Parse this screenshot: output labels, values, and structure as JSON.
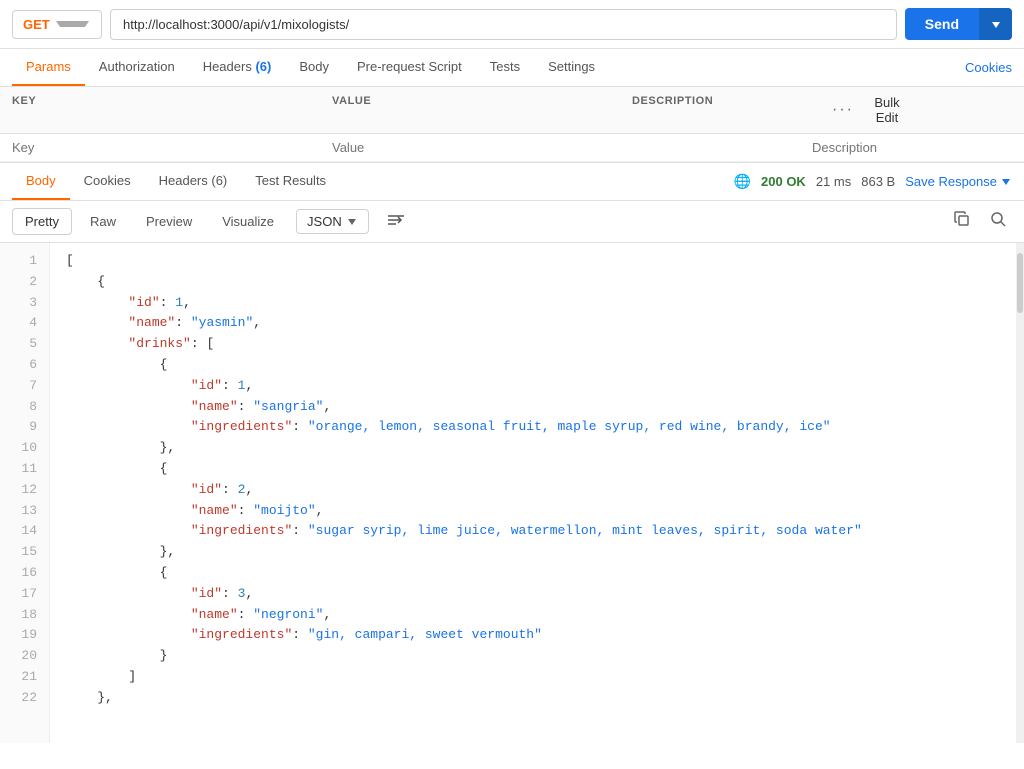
{
  "topbar": {
    "method": "GET",
    "method_color": "#f60",
    "url": "http://localhost:3000/api/v1/mixologists/",
    "send_label": "Send"
  },
  "request_tabs": [
    {
      "id": "params",
      "label": "Params",
      "active": true,
      "badge": null
    },
    {
      "id": "authorization",
      "label": "Authorization",
      "active": false,
      "badge": null
    },
    {
      "id": "headers",
      "label": "Headers",
      "active": false,
      "badge": "(6)"
    },
    {
      "id": "body",
      "label": "Body",
      "active": false,
      "badge": null
    },
    {
      "id": "prerequest",
      "label": "Pre-request Script",
      "active": false,
      "badge": null
    },
    {
      "id": "tests",
      "label": "Tests",
      "active": false,
      "badge": null
    },
    {
      "id": "settings",
      "label": "Settings",
      "active": false,
      "badge": null
    }
  ],
  "cookies_link": "Cookies",
  "params_table": {
    "columns": [
      "KEY",
      "VALUE",
      "DESCRIPTION"
    ],
    "placeholder_key": "Key",
    "placeholder_value": "Value",
    "placeholder_desc": "Description",
    "bulk_edit": "Bulk Edit"
  },
  "response_tabs": [
    {
      "id": "body",
      "label": "Body",
      "active": true
    },
    {
      "id": "cookies",
      "label": "Cookies",
      "active": false
    },
    {
      "id": "headers",
      "label": "Headers (6)",
      "active": false
    },
    {
      "id": "test_results",
      "label": "Test Results",
      "active": false
    }
  ],
  "response_status": {
    "globe": "🌐",
    "status": "200 OK",
    "time": "21 ms",
    "size": "863 B",
    "save_response": "Save Response"
  },
  "format_bar": {
    "pretty": "Pretty",
    "raw": "Raw",
    "preview": "Preview",
    "visualize": "Visualize",
    "format": "JSON",
    "wrap_icon": "≡→"
  },
  "json_lines": [
    {
      "num": 1,
      "content": "[",
      "type": "bracket"
    },
    {
      "num": 2,
      "content": "    {",
      "type": "bracket"
    },
    {
      "num": 3,
      "content": "        \"id\": 1,",
      "key": "id",
      "val": "1",
      "type": "num"
    },
    {
      "num": 4,
      "content": "        \"name\": \"yasmin\",",
      "key": "name",
      "val": "yasmin",
      "type": "str"
    },
    {
      "num": 5,
      "content": "        \"drinks\": [",
      "key": "drinks",
      "type": "arr"
    },
    {
      "num": 6,
      "content": "            {",
      "type": "bracket"
    },
    {
      "num": 7,
      "content": "                \"id\": 1,",
      "key": "id",
      "val": "1",
      "type": "num"
    },
    {
      "num": 8,
      "content": "                \"name\": \"sangria\",",
      "key": "name",
      "val": "sangria",
      "type": "str"
    },
    {
      "num": 9,
      "content": "                \"ingredients\": \"orange, lemon, seasonal fruit, maple syrup, red wine, brandy, ice\"",
      "key": "ingredients",
      "val": "orange, lemon, seasonal fruit, maple syrup, red wine, brandy, ice",
      "type": "str"
    },
    {
      "num": 10,
      "content": "            },",
      "type": "bracket"
    },
    {
      "num": 11,
      "content": "            {",
      "type": "bracket"
    },
    {
      "num": 12,
      "content": "                \"id\": 2,",
      "key": "id",
      "val": "2",
      "type": "num"
    },
    {
      "num": 13,
      "content": "                \"name\": \"moijto\",",
      "key": "name",
      "val": "moijto",
      "type": "str"
    },
    {
      "num": 14,
      "content": "                \"ingredients\": \"sugar syrip, lime juice, watermellon, mint leaves, spirit, soda water\"",
      "key": "ingredients",
      "val": "sugar syrip, lime juice, watermellon, mint leaves, spirit, soda water",
      "type": "str"
    },
    {
      "num": 15,
      "content": "            },",
      "type": "bracket"
    },
    {
      "num": 16,
      "content": "            {",
      "type": "bracket"
    },
    {
      "num": 17,
      "content": "                \"id\": 3,",
      "key": "id",
      "val": "3",
      "type": "num"
    },
    {
      "num": 18,
      "content": "                \"name\": \"negroni\",",
      "key": "name",
      "val": "negroni",
      "type": "str"
    },
    {
      "num": 19,
      "content": "                \"ingredients\": \"gin, campari, sweet vermouth\"",
      "key": "ingredients",
      "val": "gin, campari, sweet vermouth",
      "type": "str"
    },
    {
      "num": 20,
      "content": "            }",
      "type": "bracket"
    },
    {
      "num": 21,
      "content": "        ]",
      "type": "bracket"
    },
    {
      "num": 22,
      "content": "    },",
      "type": "bracket"
    }
  ]
}
